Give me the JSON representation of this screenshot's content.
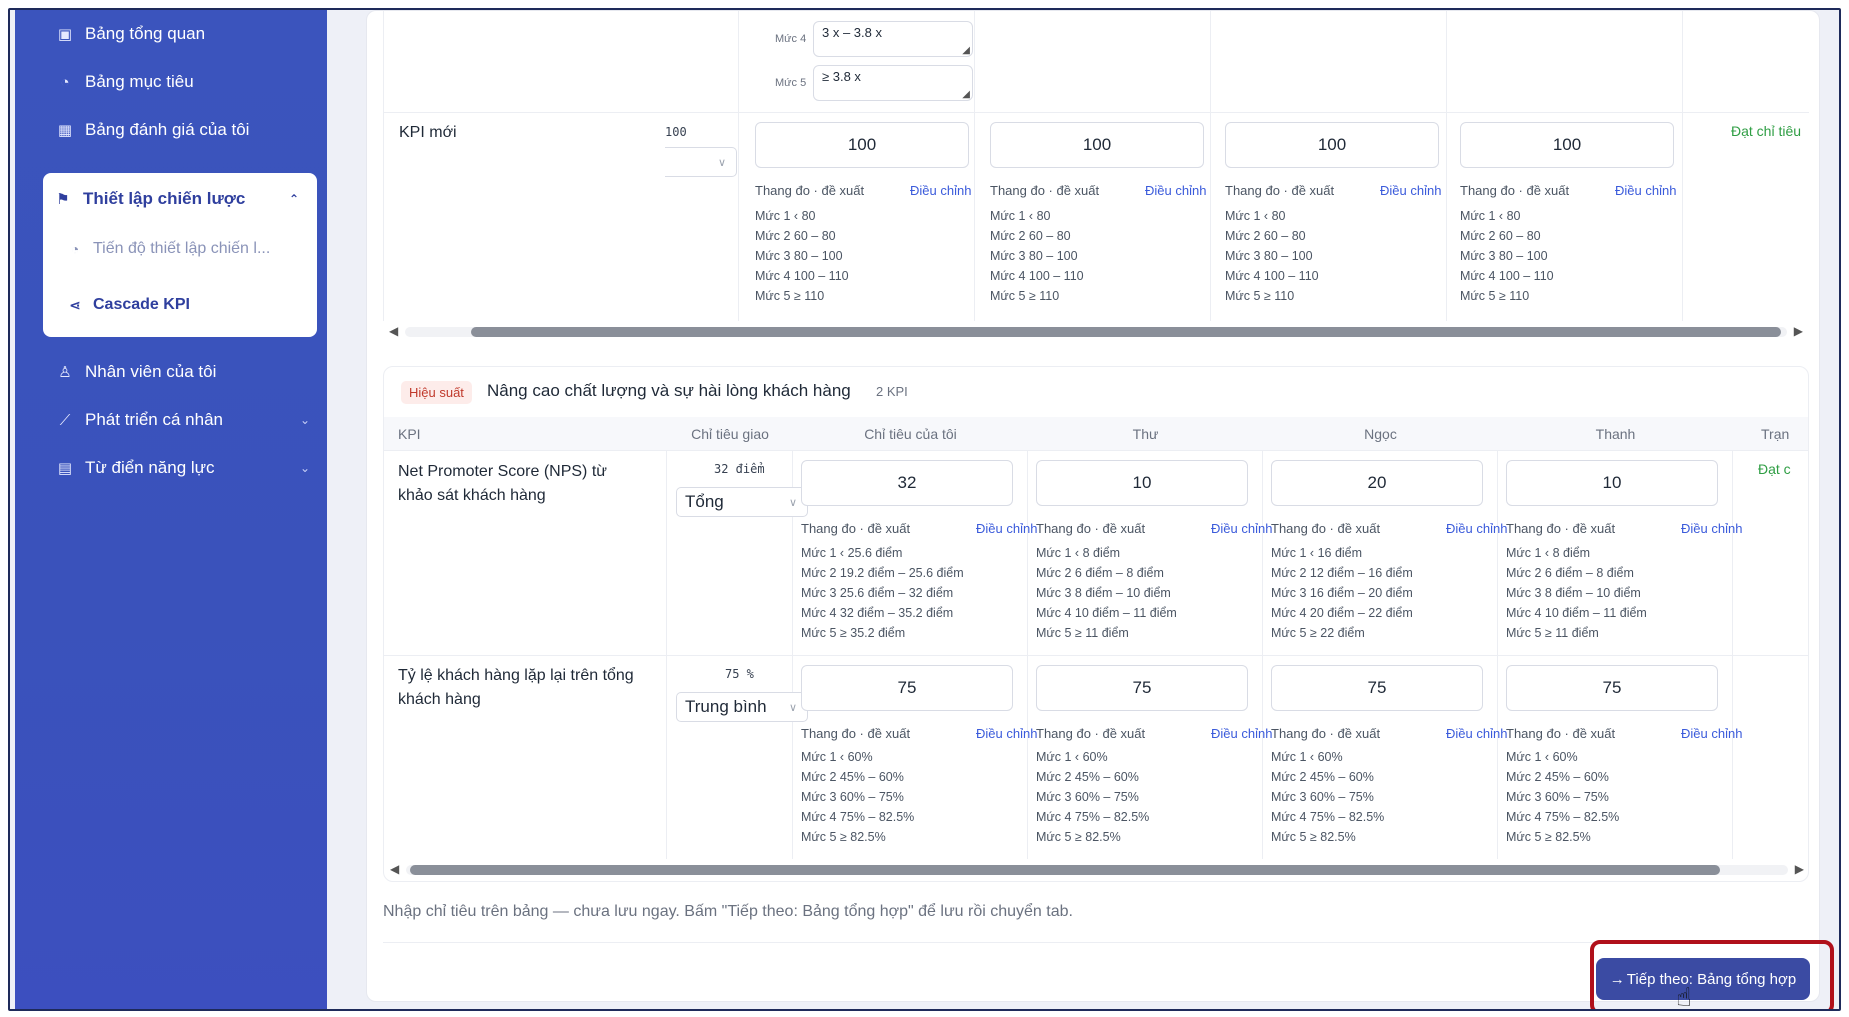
{
  "sidebar": {
    "items": [
      {
        "label": "Bảng tổng quan",
        "icon": "board-icon"
      },
      {
        "label": "Bảng mục tiêu",
        "icon": "gauge-icon"
      },
      {
        "label": "Bảng đánh giá của tôi",
        "icon": "table-icon"
      },
      {
        "label": "Nhân viên của tôi",
        "icon": "user-icon"
      },
      {
        "label": "Phát triển cá nhân",
        "icon": "trend-icon"
      },
      {
        "label": "Từ điển năng lực",
        "icon": "book-icon"
      }
    ],
    "active_group": {
      "label": "Thiết lập chiến lược",
      "icon": "flag-icon",
      "children": [
        {
          "label": "Tiến độ thiết lập chiến l...",
          "icon": "gauge-icon"
        },
        {
          "label": "Cascade KPI",
          "icon": "share-icon"
        }
      ]
    }
  },
  "top_table": {
    "levels_partial": [
      {
        "label": "Mức 4",
        "value": "3 x – 3.8 x"
      },
      {
        "label": "Mức 5",
        "value": "≥ 3.8 x"
      }
    ],
    "row": {
      "kpi": "KPI mới",
      "assigned": "100",
      "targets": [
        "100",
        "100",
        "100",
        "100"
      ],
      "scale_label": "Thang đo · đề xuất",
      "adjust_label": "Điều chỉnh",
      "scale": [
        "Mức 1  ‹ 80",
        "Mức 2  60 – 80",
        "Mức 3  80 – 100",
        "Mức 4  100 – 110",
        "Mức 5  ≥ 110"
      ],
      "status": "Đạt chỉ tiêu"
    }
  },
  "group": {
    "badge": "Hiệu suất",
    "title": "Nâng cao chất lượng và sự hài lòng khách hàng",
    "count": "2 KPI",
    "columns": [
      "KPI",
      "Chỉ tiêu giao",
      "Chỉ tiêu của tôi",
      "Thư",
      "Ngọc",
      "Thanh",
      "Trạn"
    ],
    "rows": [
      {
        "kpi": "Net Promoter Score (NPS) từ khảo sát khách hàng",
        "assigned": "32 điểm",
        "aggregation": "Tổng",
        "targets": [
          "32",
          "10",
          "20",
          "10"
        ],
        "scales": [
          [
            "Mức 1  ‹ 25.6 điểm",
            "Mức 2  19.2 điểm – 25.6 điểm",
            "Mức 3  25.6 điểm – 32 điểm",
            "Mức 4  32 điểm – 35.2 điểm",
            "Mức 5  ≥ 35.2 điểm"
          ],
          [
            "Mức 1  ‹ 8 điểm",
            "Mức 2  6 điểm – 8 điểm",
            "Mức 3  8 điểm – 10 điểm",
            "Mức 4  10 điểm – 11 điểm",
            "Mức 5  ≥ 11 điểm"
          ],
          [
            "Mức 1  ‹ 16 điểm",
            "Mức 2  12 điểm – 16 điểm",
            "Mức 3  16 điểm – 20 điểm",
            "Mức 4  20 điểm – 22 điểm",
            "Mức 5  ≥ 22 điểm"
          ],
          [
            "Mức 1  ‹ 8 điểm",
            "Mức 2  6 điểm – 8 điểm",
            "Mức 3  8 điểm – 10 điểm",
            "Mức 4  10 điểm – 11 điểm",
            "Mức 5  ≥ 11 điểm"
          ]
        ],
        "status": "Đạt c"
      },
      {
        "kpi": "Tỷ lệ khách hàng lặp lại trên tổng khách hàng",
        "assigned": "75 %",
        "aggregation": "Trung bình",
        "targets": [
          "75",
          "75",
          "75",
          "75"
        ],
        "scales": [
          [
            "Mức 1  ‹ 60%",
            "Mức 2  45% – 60%",
            "Mức 3  60% – 75%",
            "Mức 4  75% – 82.5%",
            "Mức 5  ≥ 82.5%"
          ],
          [
            "Mức 1  ‹ 60%",
            "Mức 2  45% – 60%",
            "Mức 3  60% – 75%",
            "Mức 4  75% – 82.5%",
            "Mức 5  ≥ 82.5%"
          ],
          [
            "Mức 1  ‹ 60%",
            "Mức 2  45% – 60%",
            "Mức 3  60% – 75%",
            "Mức 4  75% – 82.5%",
            "Mức 5  ≥ 82.5%"
          ],
          [
            "Mức 1  ‹ 60%",
            "Mức 2  45% – 60%",
            "Mức 3  60% – 75%",
            "Mức 4  75% – 82.5%",
            "Mức 5  ≥ 82.5%"
          ]
        ],
        "status": ""
      }
    ]
  },
  "note": "Nhập chỉ tiêu trên bảng — chưa lưu ngay. Bấm \"Tiếp theo: Bảng tổng hợp\" để lưu rồi chuyển tab.",
  "next_button": "Tiếp theo: Bảng tổng hợp",
  "colors": {
    "sidebar": "#3b54bd",
    "primary_button": "#3b4ba3",
    "highlight": "#b0101a",
    "status_ok": "#2f9e44",
    "link": "#3b5bdb"
  }
}
